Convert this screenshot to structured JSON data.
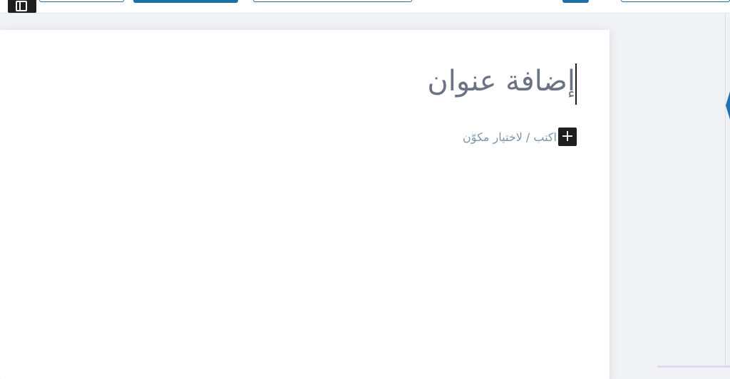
{
  "toolbar": {
    "buttons": [
      {
        "name": "toolbar-button-1",
        "style": "outline"
      },
      {
        "name": "toolbar-button-2",
        "style": "filled"
      },
      {
        "name": "toolbar-button-3",
        "style": "outline"
      },
      {
        "name": "toolbar-button-4",
        "style": "filled"
      },
      {
        "name": "toolbar-button-5",
        "style": "outline"
      }
    ],
    "sidebar_toggle_icon": "sidebar-toggle-icon"
  },
  "editor": {
    "title_placeholder": "إضافة عنوان",
    "block_placeholder": "اكتب / لاختيار مكوّن",
    "add_block_symbol": "+",
    "add_block_icon": "plus-icon"
  },
  "colors": {
    "accent": "#1e6ea7",
    "title": "#6b7283",
    "placeholder": "#7a97a8",
    "background": "#f0f2f5"
  }
}
